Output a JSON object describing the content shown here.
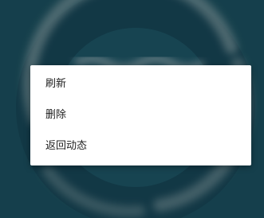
{
  "menu": {
    "items": [
      {
        "label": "刷新"
      },
      {
        "label": "删除"
      },
      {
        "label": "返回动态"
      }
    ]
  },
  "colors": {
    "background": "#1e5766",
    "menu_background": "#ffffff",
    "menu_text": "#202020"
  }
}
